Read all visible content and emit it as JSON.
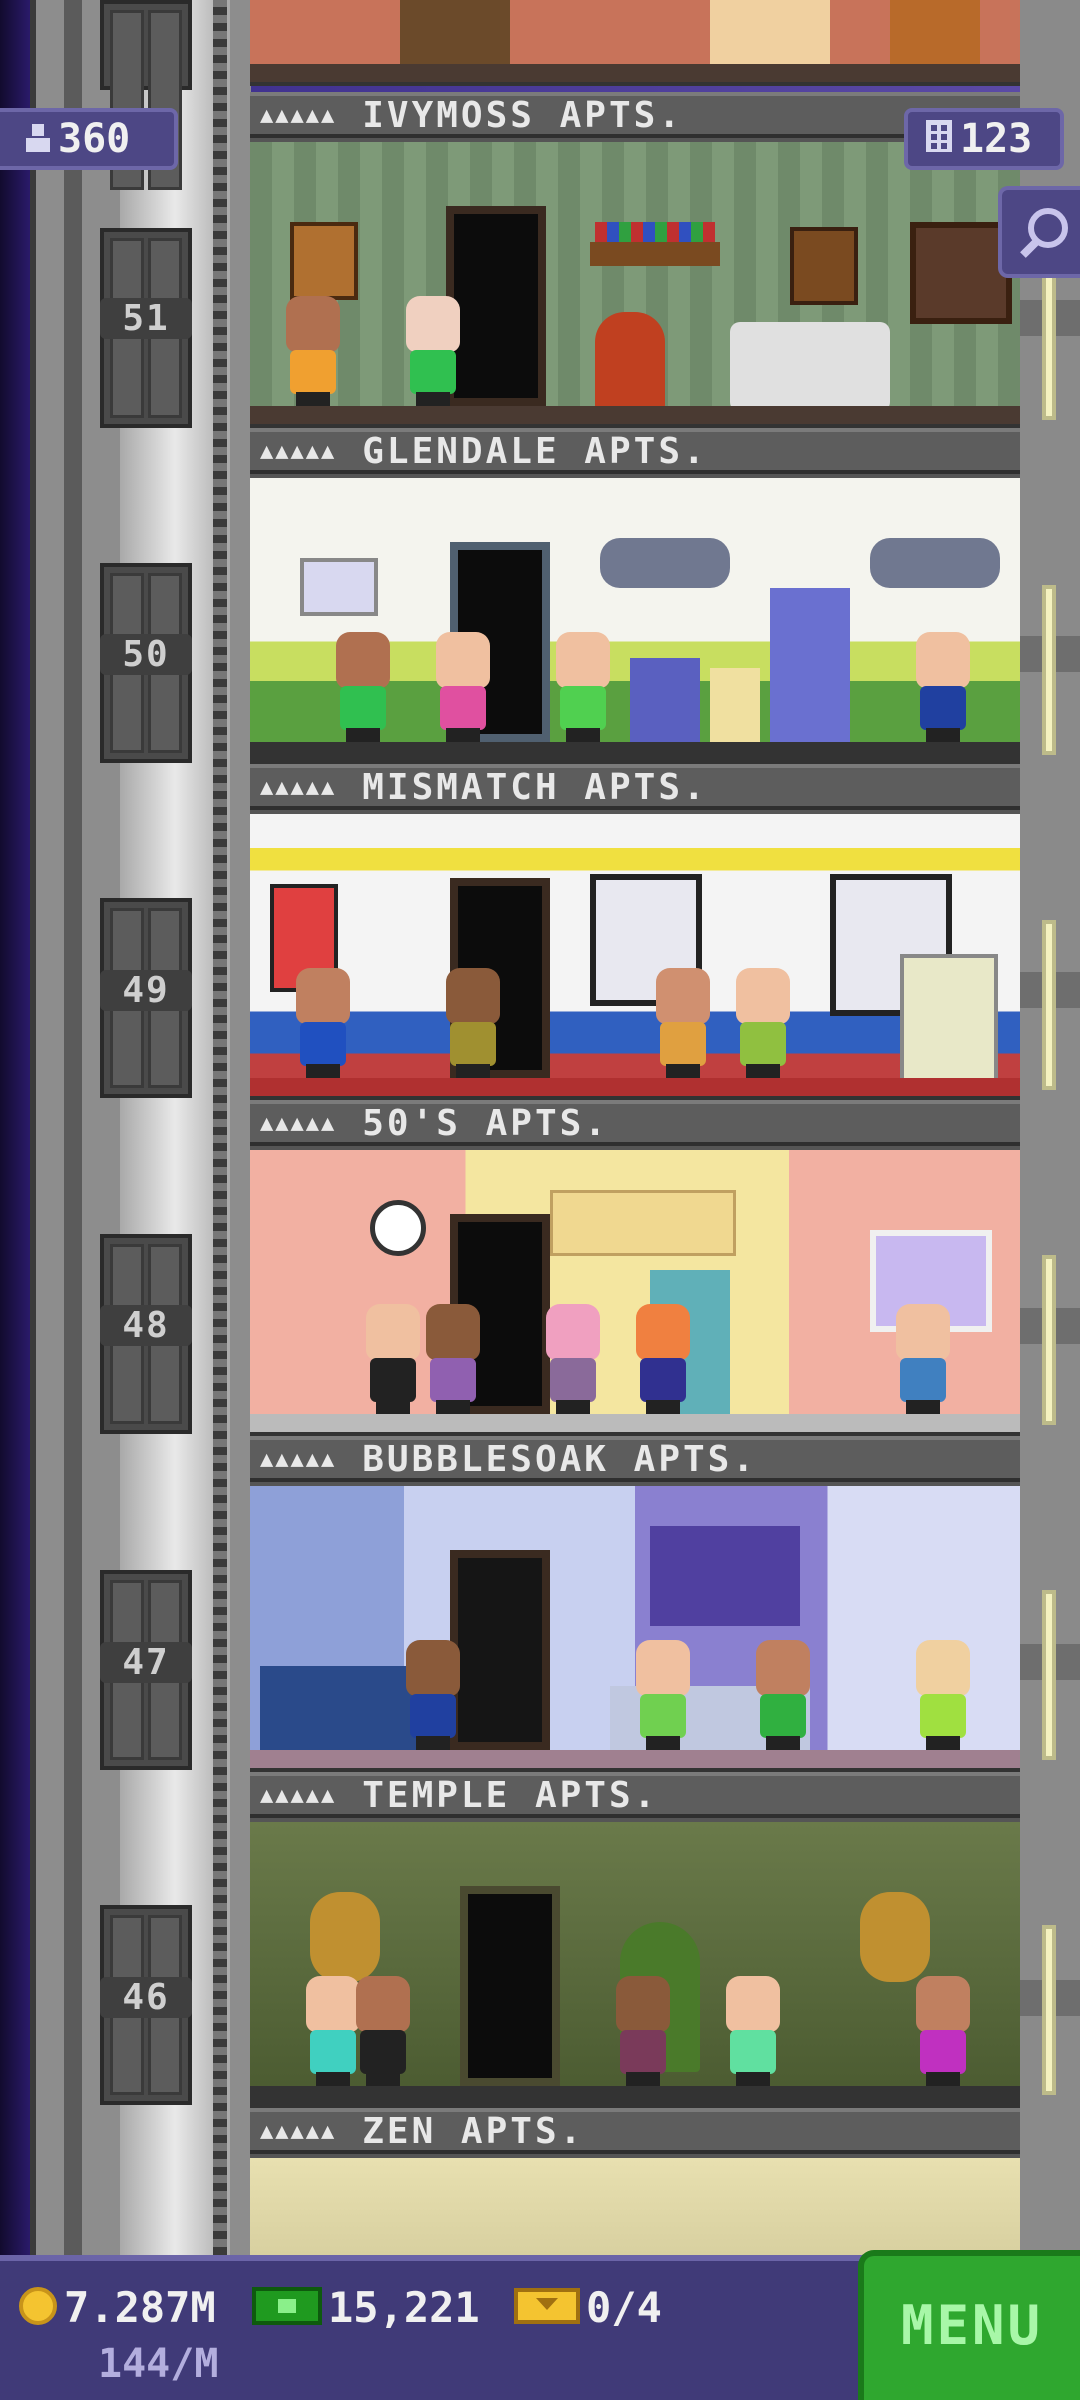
{
  "hud": {
    "population": "360",
    "floors": "123",
    "coins": "7.287M",
    "coin_rate": "144/M",
    "bux": "15,221",
    "tickets": "0/4",
    "menu_label": "MENU"
  },
  "tower": {
    "floors": [
      {
        "number": "",
        "name": "IVYMOSS APTS.",
        "stars": "▲▲▲▲▲",
        "theme": "#c8735a"
      },
      {
        "number": "51",
        "name": "GLENDALE APTS.",
        "stars": "▲▲▲▲▲",
        "theme": "#6f8a6a"
      },
      {
        "number": "50",
        "name": "MISMATCH APTS.",
        "stars": "▲▲▲▲▲",
        "theme": "#eef0e8"
      },
      {
        "number": "49",
        "name": "50'S APTS.",
        "stars": "▲▲▲▲▲",
        "theme": "#f4f4f4"
      },
      {
        "number": "48",
        "name": "BUBBLESOAK APTS.",
        "stars": "▲▲▲▲▲",
        "theme": "#f2b0a2"
      },
      {
        "number": "47",
        "name": "TEMPLE APTS.",
        "stars": "▲▲▲▲▲",
        "theme": "#9aa8d8"
      },
      {
        "number": "46",
        "name": "ZEN APTS.",
        "stars": "▲▲▲▲▲",
        "theme": "#586a3a"
      }
    ]
  },
  "icons": {
    "population": "person-icon",
    "floors": "building-icon",
    "search": "magnifier-icon",
    "coins": "coin-icon",
    "bux": "bux-icon",
    "tickets": "ticket-icon"
  },
  "colors": {
    "hud_panel": "#4d4785",
    "menu_green": "#2fa72f",
    "coin_gold": "#f4c430"
  }
}
